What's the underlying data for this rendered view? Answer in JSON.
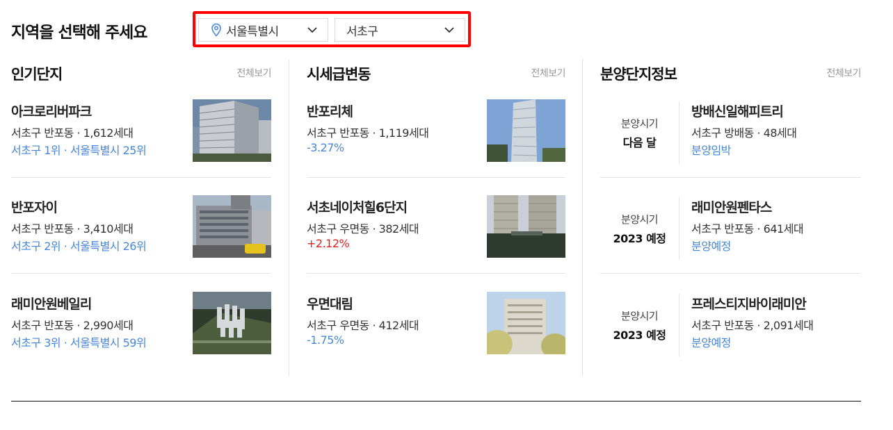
{
  "header": {
    "title": "지역을 선택해 주세요"
  },
  "region": {
    "city": "서울특별시",
    "district": "서초구"
  },
  "popular": {
    "title": "인기단지",
    "view_all": "전체보기",
    "items": [
      {
        "name": "아크로리버파크",
        "meta": "서초구 반포동 · 1,612세대",
        "rank": "서초구 1위 · 서울특별시 25위"
      },
      {
        "name": "반포자이",
        "meta": "서초구 반포동 · 3,410세대",
        "rank": "서초구 2위 · 서울특별시 26위"
      },
      {
        "name": "래미안원베일리",
        "meta": "서초구 반포동 · 2,990세대",
        "rank": "서초구 3위 · 서울특별시 59위"
      }
    ]
  },
  "price_change": {
    "title": "시세급변동",
    "view_all": "전체보기",
    "items": [
      {
        "name": "반포리체",
        "meta": "서초구 반포동 · 1,119세대",
        "change": "-3.27%"
      },
      {
        "name": "서초네이처힐6단지",
        "meta": "서초구 우면동 · 382세대",
        "change": "+2.12%"
      },
      {
        "name": "우면대림",
        "meta": "서초구 우면동 · 412세대",
        "change": "-1.75%"
      }
    ]
  },
  "presale": {
    "title": "분양단지정보",
    "view_all": "전체보기",
    "items": [
      {
        "sale_label": "분양시기",
        "sale_value": "다음 달",
        "name": "방배신일해피트리",
        "meta": "서초구 방배동 · 48세대",
        "status": "분양임박"
      },
      {
        "sale_label": "분양시기",
        "sale_value": "2023 예정",
        "name": "래미안원펜타스",
        "meta": "서초구 반포동 · 641세대",
        "status": "분양예정"
      },
      {
        "sale_label": "분양시기",
        "sale_value": "2023 예정",
        "name": "프레스티지바이래미안",
        "meta": "서초구 반포동 · 2,091세대",
        "status": "분양예정"
      }
    ]
  },
  "colors": {
    "accent_blue": "#4a86d8",
    "accent_red": "#e02020",
    "highlight_border": "#ff0000"
  }
}
